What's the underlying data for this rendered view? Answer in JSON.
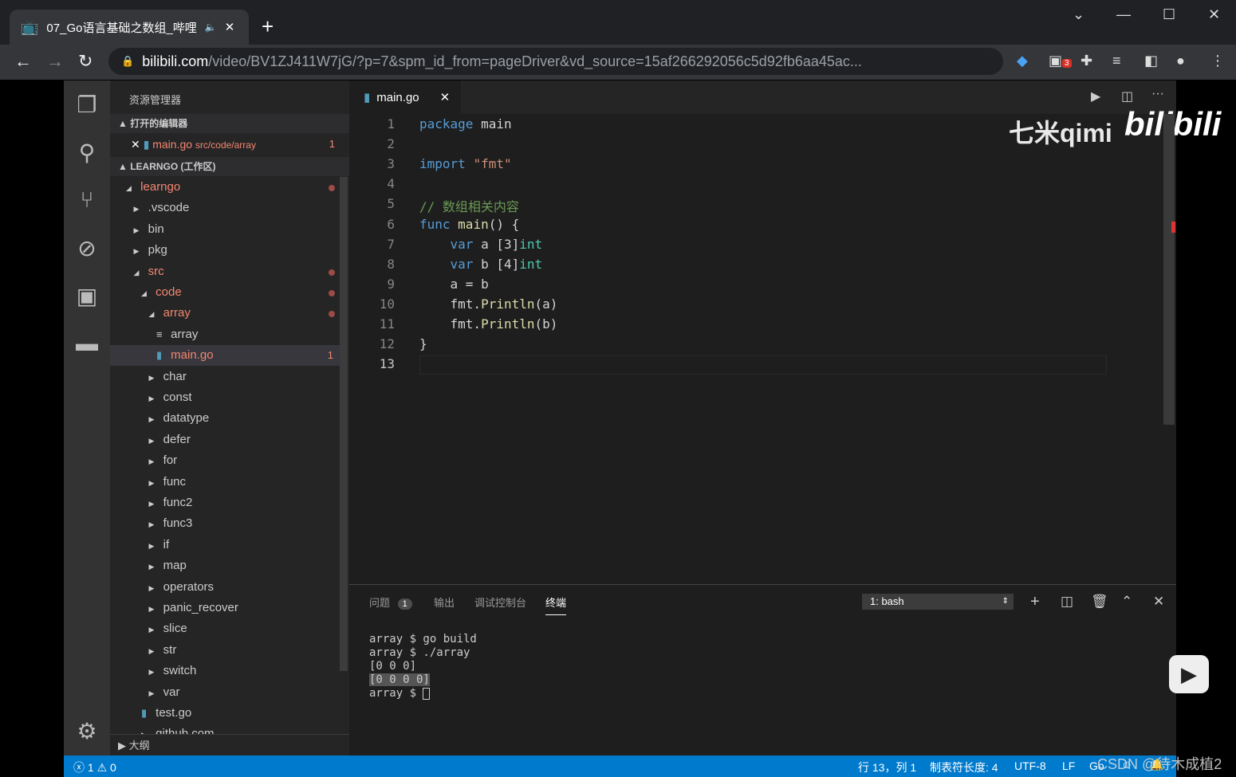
{
  "browser": {
    "tab_title": "07_Go语言基础之数组_哔哩",
    "url_host": "bilibili.com",
    "url_path": "/video/BV1ZJ411W7jG/?p=7&spm_id_from=pageDriver&vd_source=15af266292056c5d92fb6aa45ac...",
    "ext_badge": "3"
  },
  "sidebar": {
    "title": "资源管理器",
    "open_editors": "打开的编辑器",
    "open_file": "main.go",
    "open_file_path": "src/code/array",
    "open_file_badge": "1",
    "workspace": "LEARNGO (工作区)",
    "outline": "大纲",
    "tree": [
      {
        "label": "learngo",
        "level": 0,
        "tw": "▲",
        "red": true,
        "dot": true
      },
      {
        "label": ".vscode",
        "level": 1,
        "tw": "▶"
      },
      {
        "label": "bin",
        "level": 1,
        "tw": "▶"
      },
      {
        "label": "pkg",
        "level": 1,
        "tw": "▶"
      },
      {
        "label": "src",
        "level": 1,
        "tw": "▲",
        "red": true,
        "dot": true
      },
      {
        "label": "code",
        "level": 2,
        "tw": "▲",
        "red": true,
        "dot": true
      },
      {
        "label": "array",
        "level": 3,
        "tw": "▲",
        "red": true,
        "dot": true
      },
      {
        "label": "array",
        "level": 4,
        "tw": "≡"
      },
      {
        "label": "main.go",
        "level": 4,
        "tw": "go",
        "red": true,
        "sel": true,
        "badge": "1"
      },
      {
        "label": "char",
        "level": 3,
        "tw": "▶"
      },
      {
        "label": "const",
        "level": 3,
        "tw": "▶"
      },
      {
        "label": "datatype",
        "level": 3,
        "tw": "▶"
      },
      {
        "label": "defer",
        "level": 3,
        "tw": "▶"
      },
      {
        "label": "for",
        "level": 3,
        "tw": "▶"
      },
      {
        "label": "func",
        "level": 3,
        "tw": "▶"
      },
      {
        "label": "func2",
        "level": 3,
        "tw": "▶"
      },
      {
        "label": "func3",
        "level": 3,
        "tw": "▶"
      },
      {
        "label": "if",
        "level": 3,
        "tw": "▶"
      },
      {
        "label": "map",
        "level": 3,
        "tw": "▶"
      },
      {
        "label": "operators",
        "level": 3,
        "tw": "▶"
      },
      {
        "label": "panic_recover",
        "level": 3,
        "tw": "▶"
      },
      {
        "label": "slice",
        "level": 3,
        "tw": "▶"
      },
      {
        "label": "str",
        "level": 3,
        "tw": "▶"
      },
      {
        "label": "switch",
        "level": 3,
        "tw": "▶"
      },
      {
        "label": "var",
        "level": 3,
        "tw": "▶"
      },
      {
        "label": "test.go",
        "level": 2,
        "tw": "go"
      },
      {
        "label": "github.com",
        "level": 2,
        "tw": "▶"
      }
    ]
  },
  "editor": {
    "tab": "main.go",
    "lines": [
      [
        [
          "kw",
          "package"
        ],
        [
          "",
          "main"
        ]
      ],
      [],
      [
        [
          "kw",
          "import"
        ],
        [
          "",
          ""
        ],
        [
          "st",
          "\"fmt\""
        ]
      ],
      [],
      [
        [
          "cm",
          "// 数组相关内容"
        ]
      ],
      [
        [
          "kw",
          "func"
        ],
        [
          "fn",
          "main"
        ],
        [
          "",
          "() {"
        ]
      ],
      [
        [
          "",
          "    "
        ],
        [
          "kw",
          "var"
        ],
        [
          "",
          "a [3]"
        ],
        [
          "ty",
          "int"
        ]
      ],
      [
        [
          "",
          "    "
        ],
        [
          "kw",
          "var"
        ],
        [
          "",
          "b [4]"
        ],
        [
          "ty",
          "int"
        ]
      ],
      [
        [
          "",
          "    a = b"
        ]
      ],
      [
        [
          "",
          "    fmt."
        ],
        [
          "fn",
          "Println"
        ],
        [
          "",
          "(a)"
        ]
      ],
      [
        [
          "",
          "    fmt."
        ],
        [
          "fn",
          "Println"
        ],
        [
          "",
          "(b)"
        ]
      ],
      [
        [
          "",
          "}"
        ]
      ],
      []
    ],
    "watermark": "七米qimi",
    "logo": "bilibili"
  },
  "panel": {
    "tabs": [
      "问题",
      "输出",
      "调试控制台",
      "终端"
    ],
    "problems_count": "1",
    "terminal_select": "1: bash",
    "terminal": [
      "array $ go build",
      "array $ ./array",
      "[0 0 0]",
      "[0 0 0 0]",
      "array $ "
    ]
  },
  "status": {
    "errors": "1",
    "warnings": "0",
    "position": "行 13，列 1",
    "tab_size": "制表符长度: 4",
    "encoding": "UTF-8",
    "eol": "LF",
    "lang": "Go",
    "csdn": "CSDN @待木成植2"
  }
}
